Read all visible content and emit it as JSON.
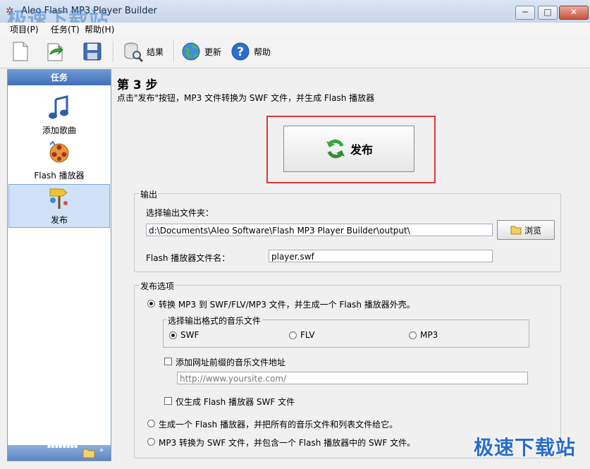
{
  "window": {
    "title": "Aleo Flash MP3 Player Builder",
    "minimize": "─",
    "maximize": "□",
    "close": "✕"
  },
  "watermark": {
    "top": "极速下载站",
    "bottom": "极速下载站"
  },
  "menu": [
    {
      "label": "项目(P)"
    },
    {
      "label": "任务(T)"
    },
    {
      "label": "帮助(H)"
    }
  ],
  "toolbar": {
    "results_label": "结果",
    "update_label": "更新",
    "help_label": "帮助"
  },
  "sidebar": {
    "header": "任务",
    "items": [
      {
        "label": "添加歌曲"
      },
      {
        "label": "Flash 播放器"
      },
      {
        "label": "发布"
      }
    ]
  },
  "main": {
    "step_title": "第 3 步",
    "step_desc": "点击\"发布\"按钮，MP3 文件转换为 SWF 文件，并生成 Flash 播放器",
    "publish_label": "发布",
    "output": {
      "legend": "输出",
      "folder_label": "选择输出文件夹：",
      "folder_value": "d:\\Documents\\Aleo Software\\Flash MP3 Player Builder\\output\\",
      "browse_label": "浏览",
      "player_name_label": "Flash 播放器文件名：",
      "player_name_value": "player.swf"
    },
    "options": {
      "legend": "发布选项",
      "opt1": "转换 MP3 到 SWF/FLV/MP3 文件，并生成一个 Flash 播放器外壳。",
      "format_legend": "选择输出格式的音乐文件",
      "fmt_swf": "SWF",
      "fmt_flv": "FLV",
      "fmt_mp3": "MP3",
      "url_prefix_label": "添加网址前缀的音乐文件地址",
      "url_placeholder": "http://www.yoursite.com/",
      "only_swf_label": "仅生成 Flash 播放器 SWF 文件",
      "opt2": "生成一个 Flash 播放器，并把所有的音乐文件和列表文件给它。",
      "opt3": "MP3 转换为 SWF 文件，并包含一个 Flash 播放器中的 SWF 文件。"
    }
  }
}
